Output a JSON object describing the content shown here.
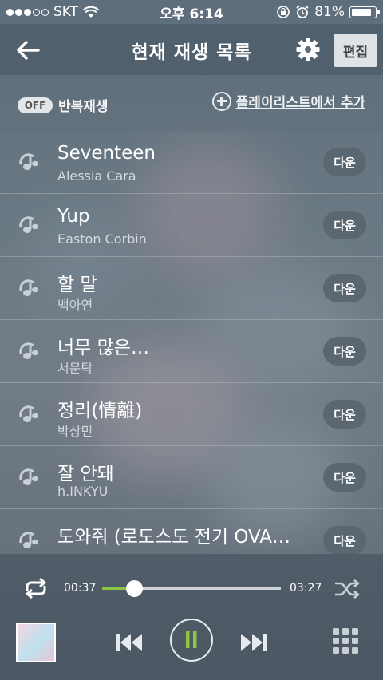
{
  "status_bar": {
    "carrier": "SKT",
    "time": "오후 6:14",
    "battery": "81%",
    "battery_level": 0.81,
    "signal_bars": 3,
    "icons": [
      "wifi-icon",
      "orientation-lock-icon",
      "alarm-icon",
      "battery-icon"
    ]
  },
  "nav": {
    "title": "현재 재생 목록",
    "edit_label": "편집",
    "icons": [
      "back-arrow-icon",
      "gear-icon"
    ]
  },
  "options": {
    "repeat_toggle": "OFF",
    "repeat_label": "반복재생",
    "add_from_playlist": "플레이리스트에서 추가"
  },
  "tracks": [
    {
      "title": "Seventeen",
      "artist": "Alessia Cara",
      "action": "다운"
    },
    {
      "title": "Yup",
      "artist": "Easton Corbin",
      "action": "다운"
    },
    {
      "title": "할 말",
      "artist": "백아연",
      "action": "다운"
    },
    {
      "title": "너무 많은…",
      "artist": "서문탁",
      "action": "다운"
    },
    {
      "title": "정리(情離)",
      "artist": "박상민",
      "action": "다운"
    },
    {
      "title": "잘 안돼",
      "artist": "h.INKYU",
      "action": "다운"
    },
    {
      "title": "도와줘 (로도스도 전기 OVA…",
      "artist": "",
      "action": "다운"
    }
  ],
  "player": {
    "current_time": "00:37",
    "total_time": "03:27",
    "progress": 0.18,
    "state": "playing",
    "accent_color": "#8cc63f",
    "icons": [
      "repeat-icon",
      "shuffle-icon",
      "previous-icon",
      "pause-icon",
      "next-icon",
      "grid-menu-icon",
      "album-art"
    ]
  }
}
